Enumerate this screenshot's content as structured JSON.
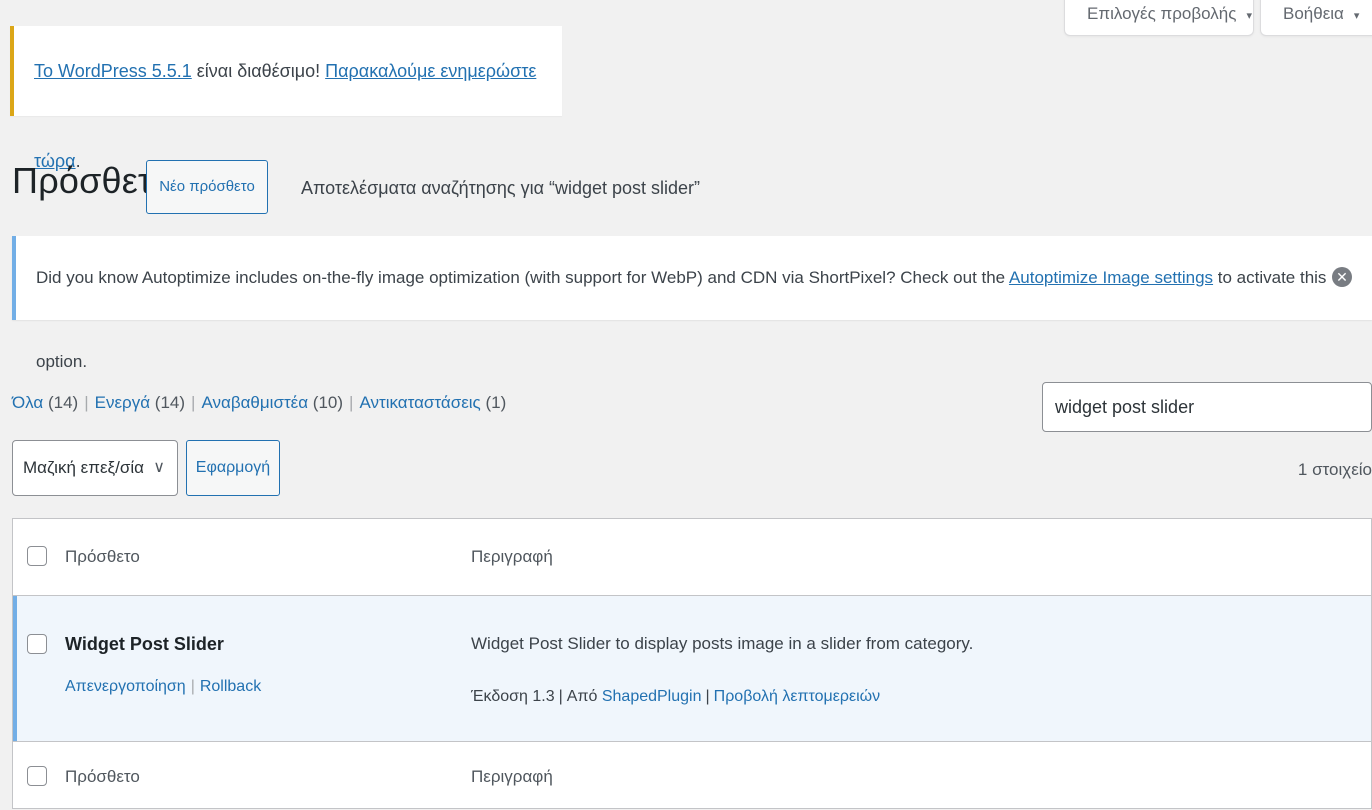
{
  "screen_options": {
    "options_label": "Επιλογές προβολής",
    "help_label": "Βοήθεια"
  },
  "update_nag": {
    "link1": "Το WordPress 5.5.1",
    "text": " είναι διαθέσιμο! ",
    "link2": "Παρακαλούμε ενημερώστε τώρα",
    "end": "."
  },
  "header": {
    "title": "Πρόσθετα",
    "add_new": "Νέο πρόσθετο",
    "search_results": "Αποτελέσματα αναζήτησης για “widget post slider”"
  },
  "notice": {
    "text_before": "Did you know Autoptimize includes on-the-fly image optimization (with support for WebP) and CDN via ShortPixel? Check out the ",
    "link": "Autoptimize Image settings",
    "text_after": " to activate this option."
  },
  "filters": [
    {
      "label": "Όλα",
      "count": "(14)"
    },
    {
      "label": "Ενεργά",
      "count": "(14)"
    },
    {
      "label": "Αναβαθμιστέα",
      "count": "(10)"
    },
    {
      "label": "Αντικαταστάσεις",
      "count": "(1)"
    }
  ],
  "search": {
    "value": "widget post slider"
  },
  "bulk": {
    "selected": "Μαζική επεξ/σία",
    "apply": "Εφαρμογή",
    "items_count": "1 στοιχείο"
  },
  "table": {
    "col_plugin": "Πρόσθετο",
    "col_description": "Περιγραφή",
    "plugin": {
      "name": "Widget Post Slider",
      "action_deactivate": "Απενεργοποίηση",
      "action_rollback": "Rollback",
      "description": "Widget Post Slider to display posts image in a slider from category.",
      "version": "Έκδοση 1.3",
      "by": "Από",
      "author": "ShapedPlugin",
      "details": "Προβολή λεπτομερειών"
    }
  }
}
